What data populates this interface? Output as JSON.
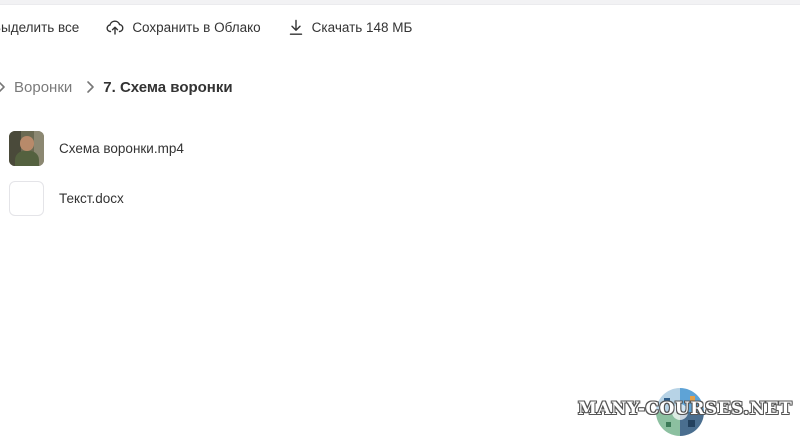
{
  "toolbar": {
    "select_all_label": "Выделить все",
    "save_cloud_label": "Сохранить в Облако",
    "download_label": "Скачать 148 МБ"
  },
  "breadcrumb": {
    "items": [
      {
        "label": "Воронки"
      },
      {
        "label": "7. Схема воронки"
      }
    ]
  },
  "files": [
    {
      "name": "Схема воронки.mp4",
      "kind": "video",
      "thumb_icon": "video-thumbnail"
    },
    {
      "name": "Текст.docx",
      "kind": "document",
      "thumb_icon": "document-thumbnail"
    }
  ],
  "watermark": {
    "text": "MANY-COURSES.NET"
  },
  "colors": {
    "text": "#333333",
    "muted": "#7a7a7a",
    "border": "#e4e4e8"
  }
}
